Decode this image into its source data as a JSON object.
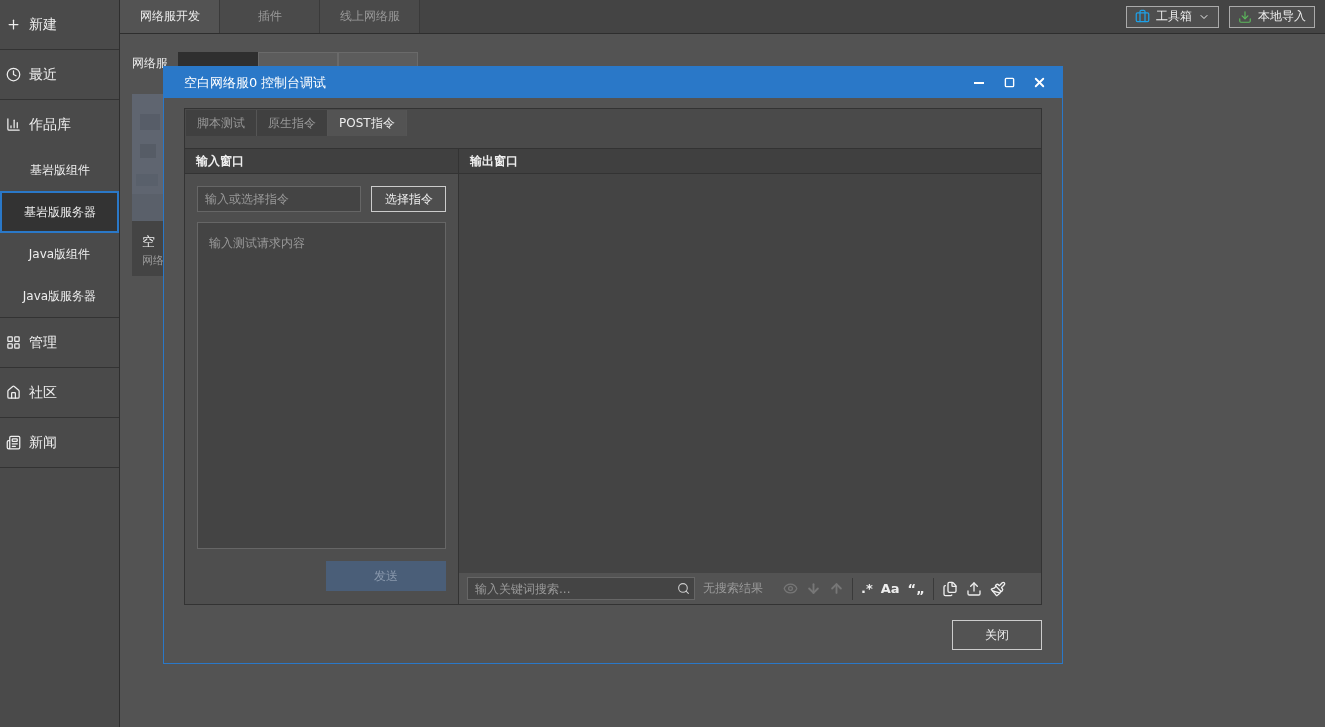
{
  "sidebar": {
    "items": [
      {
        "label": "新建"
      },
      {
        "label": "最近"
      },
      {
        "label": "作品库",
        "children": [
          {
            "label": "基岩版组件",
            "selected": false
          },
          {
            "label": "基岩版服务器",
            "selected": true
          },
          {
            "label": "Java版组件",
            "selected": false
          },
          {
            "label": "Java版服务器",
            "selected": false
          }
        ]
      },
      {
        "label": "管理"
      },
      {
        "label": "社区"
      },
      {
        "label": "新闻"
      }
    ]
  },
  "top_tabs": [
    {
      "label": "网络服开发",
      "selected": true
    },
    {
      "label": "插件",
      "selected": false
    },
    {
      "label": "线上网络服",
      "selected": false
    }
  ],
  "toolbar": {
    "toolbox_button": "工具箱",
    "import_button": "本地导入"
  },
  "stage": {
    "label": "网络服",
    "options": [
      {
        "selected": true
      },
      {
        "selected": false
      },
      {
        "selected": false
      }
    ]
  },
  "card": {
    "title": "空",
    "subtitle": "网络"
  },
  "dialog": {
    "title": "空白网络服0 控制台调试",
    "tabs": [
      {
        "label": "脚本测试",
        "selected": false
      },
      {
        "label": "原生指令",
        "selected": false
      },
      {
        "label": "POST指令",
        "selected": true
      }
    ],
    "input_pane": {
      "header": "输入窗口",
      "command_placeholder": "输入或选择指令",
      "choose_button": "选择指令",
      "body_placeholder": "输入测试请求内容",
      "send_button": "发送",
      "send_disabled": true
    },
    "output_pane": {
      "header": "输出窗口",
      "search_placeholder": "输入关键词搜索...",
      "search_status": "无搜索结果",
      "regex_toggle": ".*",
      "case_toggle": "Aa",
      "word_toggle": "“„"
    },
    "close_button": "关闭"
  }
}
